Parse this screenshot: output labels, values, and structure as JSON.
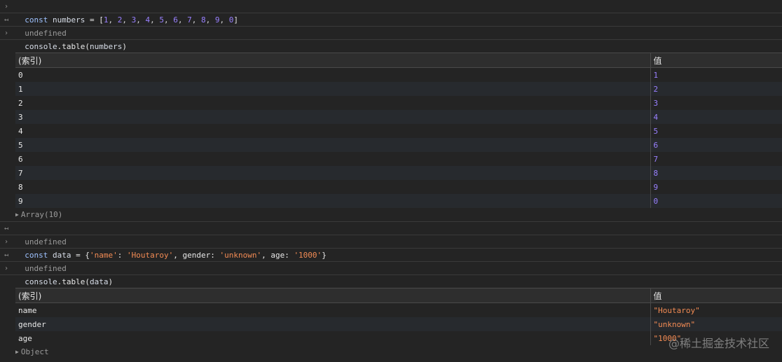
{
  "console": {
    "line1": {
      "kw": "const",
      "ident": "numbers",
      "eq": " = [",
      "n": [
        "1",
        "2",
        "3",
        "4",
        "5",
        "6",
        "7",
        "8",
        "9",
        "0"
      ],
      "close": "]"
    },
    "out1": "undefined",
    "line2": {
      "obj": "console",
      "call": ".table(",
      "arg": "numbers",
      "close": ")"
    },
    "table1": {
      "headers": [
        "(索引)",
        "值"
      ],
      "rows": [
        [
          "0",
          "1"
        ],
        [
          "1",
          "2"
        ],
        [
          "2",
          "3"
        ],
        [
          "3",
          "4"
        ],
        [
          "4",
          "5"
        ],
        [
          "5",
          "6"
        ],
        [
          "6",
          "7"
        ],
        [
          "7",
          "8"
        ],
        [
          "8",
          "9"
        ],
        [
          "9",
          "0"
        ]
      ],
      "summary": "Array(10)"
    },
    "out2": "undefined",
    "line3": {
      "kw": "const",
      "ident": "data",
      "p1": " = {",
      "k1": "'name'",
      "p2": ": ",
      "v1": "'Houtaroy'",
      "p3": ", gender: ",
      "v2": "'unknown'",
      "p4": ", age: ",
      "v3": "'1000'",
      "p5": "}"
    },
    "out3": "undefined",
    "line4": {
      "obj": "console",
      "call": ".table(",
      "arg": "data",
      "close": ")"
    },
    "table2": {
      "headers": [
        "(索引)",
        "值"
      ],
      "rows": [
        [
          "name",
          "\"Houtaroy\""
        ],
        [
          "gender",
          "\"unknown\""
        ],
        [
          "age",
          "\"1000\""
        ]
      ],
      "summary": "Object"
    }
  },
  "icons": {
    "input_prompt": "chevron-right-icon",
    "output_return": "return-arrow-icon",
    "expand": "triangle-right-icon"
  },
  "colors": {
    "background": "#242424",
    "number": "#9980ff",
    "string": "#f28b54",
    "keyword": "#9ec2ff"
  },
  "watermark": "@稀土掘金技术社区"
}
